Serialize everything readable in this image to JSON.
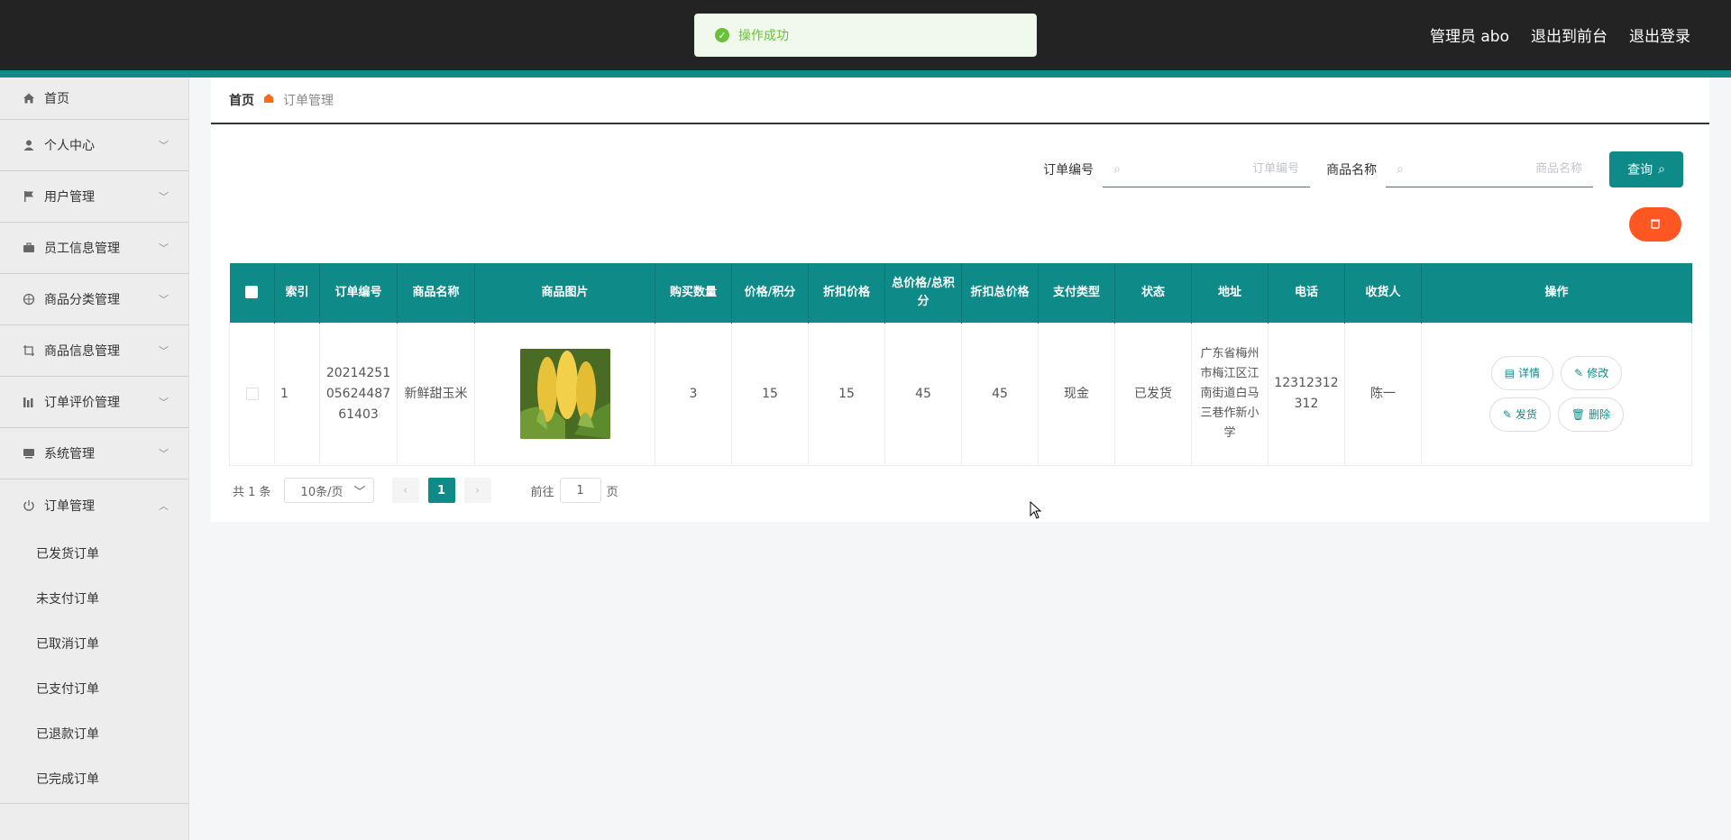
{
  "topbar": {
    "admin_label": "管理员 abo",
    "to_frontend": "退出到前台",
    "logout": "退出登录"
  },
  "toast": {
    "message": "操作成功"
  },
  "sidebar": {
    "items": [
      {
        "label": "首页",
        "icon": "home-icon"
      },
      {
        "label": "个人中心",
        "icon": "user-icon"
      },
      {
        "label": "用户管理",
        "icon": "flag-icon"
      },
      {
        "label": "员工信息管理",
        "icon": "briefcase-icon"
      },
      {
        "label": "商品分类管理",
        "icon": "compass-icon"
      },
      {
        "label": "商品信息管理",
        "icon": "crop-icon"
      },
      {
        "label": "订单评价管理",
        "icon": "bar-chart-icon"
      },
      {
        "label": "系统管理",
        "icon": "monitor-icon"
      },
      {
        "label": "订单管理",
        "icon": "power-icon"
      }
    ],
    "order_sub": [
      "已发货订单",
      "未支付订单",
      "已取消订单",
      "已支付订单",
      "已退款订单",
      "已完成订单"
    ]
  },
  "breadcrumb": {
    "home": "首页",
    "current": "订单管理"
  },
  "search": {
    "order_no_label": "订单编号",
    "order_no_placeholder": "订单编号",
    "product_label": "商品名称",
    "product_placeholder": "商品名称",
    "query_label": "查询"
  },
  "table": {
    "headers": [
      "索引",
      "订单编号",
      "商品名称",
      "商品图片",
      "购买数量",
      "价格/积分",
      "折扣价格",
      "总价格/总积分",
      "折扣总价格",
      "支付类型",
      "状态",
      "地址",
      "电话",
      "收货人",
      "操作"
    ],
    "rows": [
      {
        "index": "1",
        "order_no": "202142510562448761403",
        "product": "新鲜甜玉米",
        "qty": "3",
        "price": "15",
        "discount_price": "15",
        "total": "45",
        "discount_total": "45",
        "pay_type": "现金",
        "status": "已发货",
        "address": "广东省梅州市梅江区江南街道白马三巷作新小学",
        "phone": "12312312312",
        "receiver": "陈一"
      }
    ],
    "actions": {
      "detail": "详情",
      "edit": "修改",
      "ship": "发货",
      "delete": "删除"
    }
  },
  "pager": {
    "total": "共 1 条",
    "page_size": "10条/页",
    "current_page": "1",
    "goto_prefix": "前往",
    "goto_value": "1",
    "goto_suffix": "页"
  },
  "colors": {
    "primary": "#0e8a89",
    "danger": "#ff5722",
    "topbar": "#232323"
  }
}
